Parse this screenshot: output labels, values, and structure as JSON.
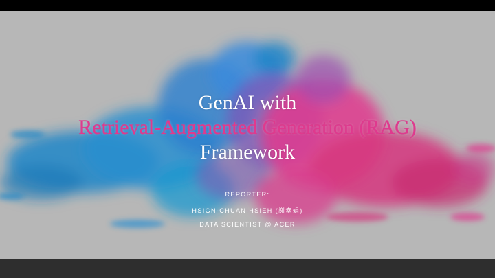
{
  "slide": {
    "title_line1": "GenAI with",
    "title_line2": "Retrieval-Augmented Generation (RAG)",
    "title_line3": "Framework",
    "reporter_label": "REPORTER:",
    "reporter_name": "HSIGN-CHUAN HSIEH (謝幸娟)",
    "reporter_title": "DATA SCIENTIST @ ACER"
  },
  "colors": {
    "slide_background": "#b7b7b7",
    "ink_blue": "#1f86c8",
    "ink_pink": "#e0398e",
    "title_white": "#ffffff"
  }
}
